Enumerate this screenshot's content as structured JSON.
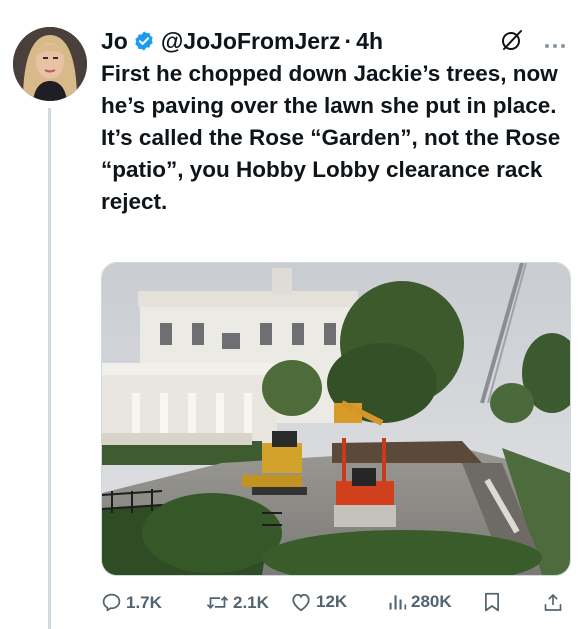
{
  "tweet": {
    "author_name": "Jo",
    "handle": "@JoJoFromJerz",
    "separator": "·",
    "time": "4h",
    "text_lines": [
      "First he chopped down Jackie’s trees, now he’s paving over the lawn she put in place.",
      "It’s called the Rose “Garden”, not the Rose “patio”, you Hobby Lobby clearance rack reject."
    ],
    "icons": {
      "verified": "verified-badge-icon",
      "grok": "grok-icon",
      "more": "more-icon"
    }
  },
  "actions": {
    "replies": "1.7K",
    "reposts": "2.1K",
    "likes": "12K",
    "views": "280K"
  },
  "colors": {
    "verified": "#1d9bf0",
    "action_gray": "#536471",
    "thread_line": "#cfd9de"
  }
}
